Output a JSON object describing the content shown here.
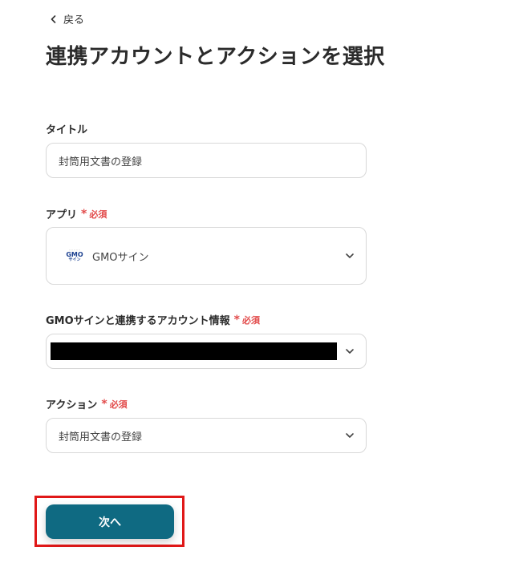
{
  "back": {
    "label": "戻る"
  },
  "page": {
    "title": "連携アカウントとアクションを選択"
  },
  "fields": {
    "title": {
      "label": "タイトル",
      "value": "封筒用文書の登録"
    },
    "app": {
      "label": "アプリ",
      "required": "必須",
      "value": "GMOサイン",
      "logo_text": [
        "GMO",
        "サイン"
      ]
    },
    "account": {
      "label": "GMOサインと連携するアカウント情報",
      "required": "必須"
    },
    "action": {
      "label": "アクション",
      "required": "必須",
      "value": "封筒用文書の登録"
    }
  },
  "footer": {
    "next_label": "次へ"
  },
  "colors": {
    "primary": "#0f6a82",
    "required": "#e24a4a",
    "highlight": "#e01818"
  },
  "icons": {
    "back": "chevron-left-icon",
    "dropdown": "chevron-down-icon",
    "app_logo": "gmo-sign-logo-icon"
  }
}
